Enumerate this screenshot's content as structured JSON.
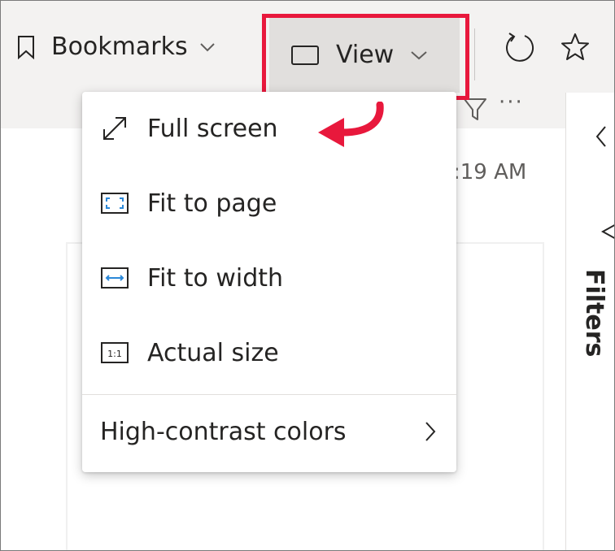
{
  "toolbar": {
    "bookmarks_label": "Bookmarks",
    "view_label": "View"
  },
  "report": {
    "timestamp": ":19 AM",
    "more": "···"
  },
  "right_pane": {
    "filters_label": "Filters"
  },
  "view_menu": {
    "items": [
      {
        "label": "Full screen",
        "icon": "full-screen-icon"
      },
      {
        "label": "Fit to page",
        "icon": "fit-to-page-icon"
      },
      {
        "label": "Fit to width",
        "icon": "fit-to-width-icon"
      },
      {
        "label": "Actual size",
        "icon": "actual-size-icon"
      }
    ],
    "high_contrast_label": "High-contrast colors"
  },
  "colors": {
    "highlight": "#e8183c",
    "arrow": "#e8183c",
    "icon_blue": "#2b88d8"
  }
}
